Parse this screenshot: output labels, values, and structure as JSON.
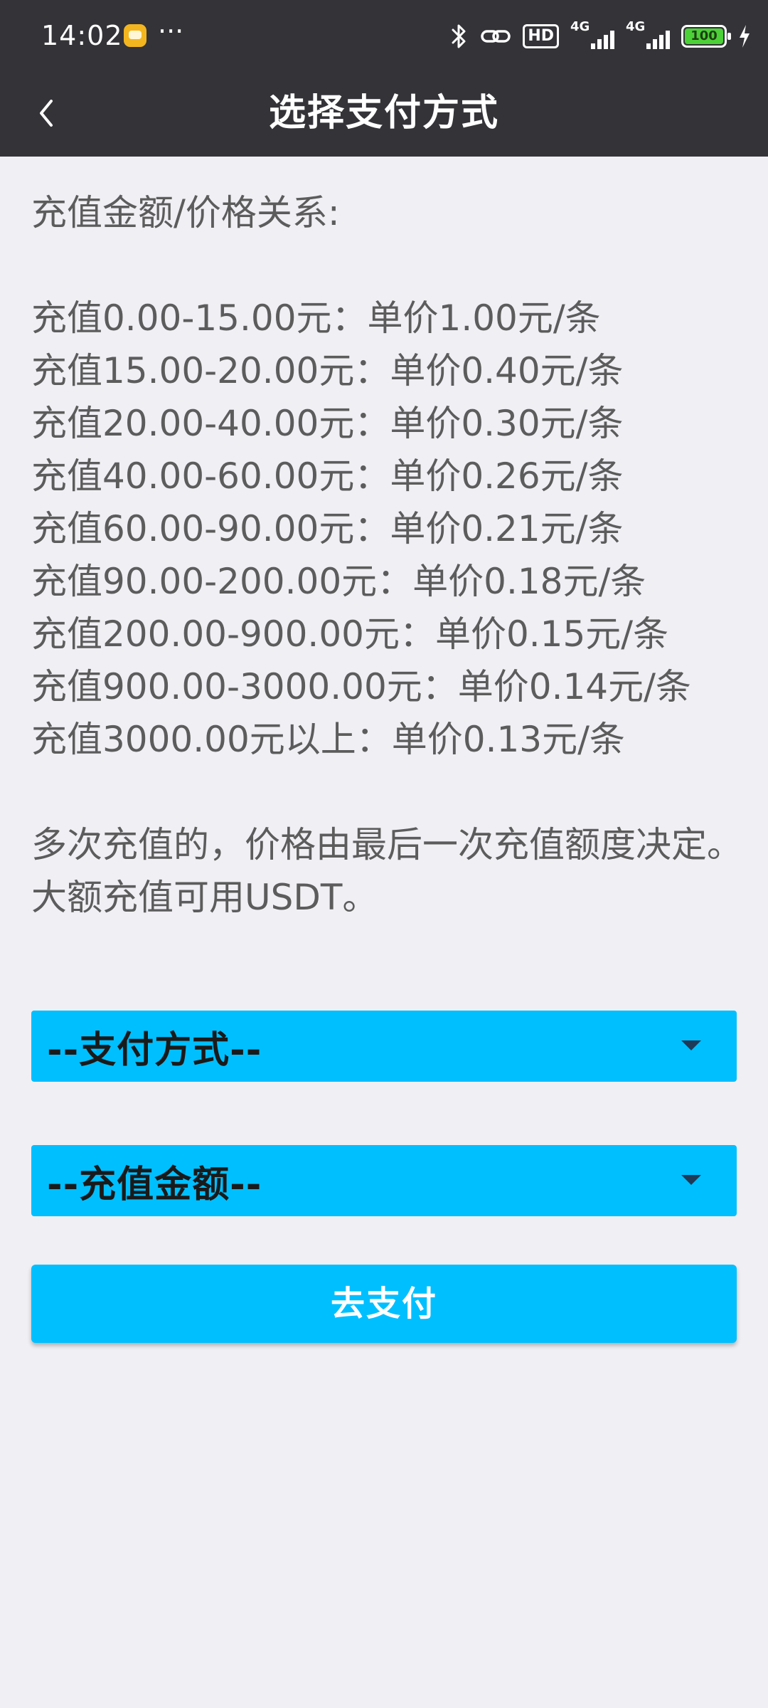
{
  "status_bar": {
    "time": "14:02",
    "more": "···",
    "hd": "HD",
    "network_1": "4G",
    "network_2": "4G",
    "battery": "100"
  },
  "header": {
    "title": "选择支付方式"
  },
  "pricing": {
    "heading": "充值金额/价格关系:",
    "tiers": [
      "充值0.00-15.00元：单价1.00元/条",
      "充值15.00-20.00元：单价0.40元/条",
      "充值20.00-40.00元：单价0.30元/条",
      "充值40.00-60.00元：单价0.26元/条",
      "充值60.00-90.00元：单价0.21元/条",
      "充值90.00-200.00元：单价0.18元/条",
      "充值200.00-900.00元：单价0.15元/条",
      "充值900.00-3000.00元：单价0.14元/条",
      "充值3000.00元以上：单价0.13元/条"
    ],
    "note": "多次充值的，价格由最后一次充值额度决定。大额充值可用USDT。"
  },
  "form": {
    "payment_method_label": "--支付方式--",
    "amount_label": "--充值金额--",
    "submit_label": "去支付"
  },
  "colors": {
    "accent": "#00bfff",
    "header_bg": "#333338",
    "page_bg": "#f0eff4"
  }
}
